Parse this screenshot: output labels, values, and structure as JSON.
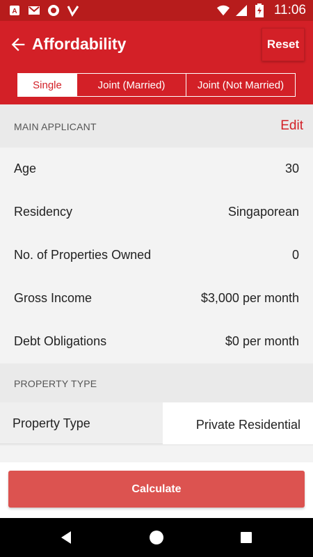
{
  "status_bar": {
    "time": "11:06",
    "left_icons": [
      "adobe-notification-icon",
      "gmail-notification-icon",
      "record-notification-icon",
      "check-notification-icon"
    ],
    "right_icons": [
      "wifi-icon",
      "signal-icon",
      "battery-charging-icon"
    ]
  },
  "app_bar": {
    "title": "Affordability",
    "reset_label": "Reset"
  },
  "tabs": [
    {
      "label": "Single",
      "active": true
    },
    {
      "label": "Joint (Married)",
      "active": false
    },
    {
      "label": "Joint (Not Married)",
      "active": false
    }
  ],
  "main_applicant": {
    "header": "MAIN APPLICANT",
    "edit_label": "Edit",
    "rows": [
      {
        "label": "Age",
        "value": "30"
      },
      {
        "label": "Residency",
        "value": "Singaporean"
      },
      {
        "label": "No. of Properties Owned",
        "value": "0"
      },
      {
        "label": "Gross Income",
        "value": "$3,000 per month"
      },
      {
        "label": "Debt Obligations",
        "value": "$0 per month"
      }
    ]
  },
  "property": {
    "header": "PROPERTY TYPE",
    "label": "Property Type",
    "value": "Private Residential"
  },
  "calculate_label": "Calculate",
  "colors": {
    "status_bar": "#b71c1c",
    "app_bar": "#d32027",
    "button": "#dc5350"
  }
}
